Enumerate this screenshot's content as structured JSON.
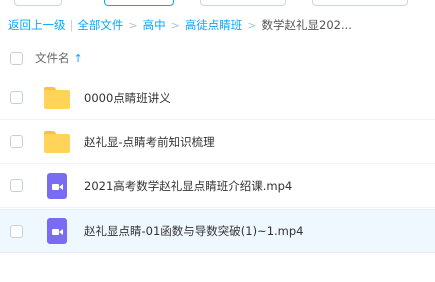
{
  "breadcrumb": {
    "back_label": "返回上一级",
    "all_files_label": "全部文件",
    "items": [
      "高中",
      "高徒点睛班"
    ],
    "current": "数学赵礼显202..."
  },
  "list_header": {
    "column_label": "文件名",
    "sort_icon": "arrow-up-icon"
  },
  "files": [
    {
      "name": "0000点睛班讲义",
      "type": "folder",
      "icon": "folder-icon"
    },
    {
      "name": "赵礼显-点睛考前知识梳理",
      "type": "folder",
      "icon": "folder-icon"
    },
    {
      "name": "2021高考数学赵礼显点睛班介绍课.mp4",
      "type": "video",
      "icon": "video-file-icon"
    },
    {
      "name": "赵礼显点睛-01函数与导数突破(1)~1.mp4",
      "type": "video",
      "icon": "video-file-icon",
      "selected": true
    }
  ],
  "colors": {
    "link": "#06a7ff",
    "folder": "#ffd459",
    "video": "#7a6cf0",
    "selected_row": "#f0f8ff"
  }
}
